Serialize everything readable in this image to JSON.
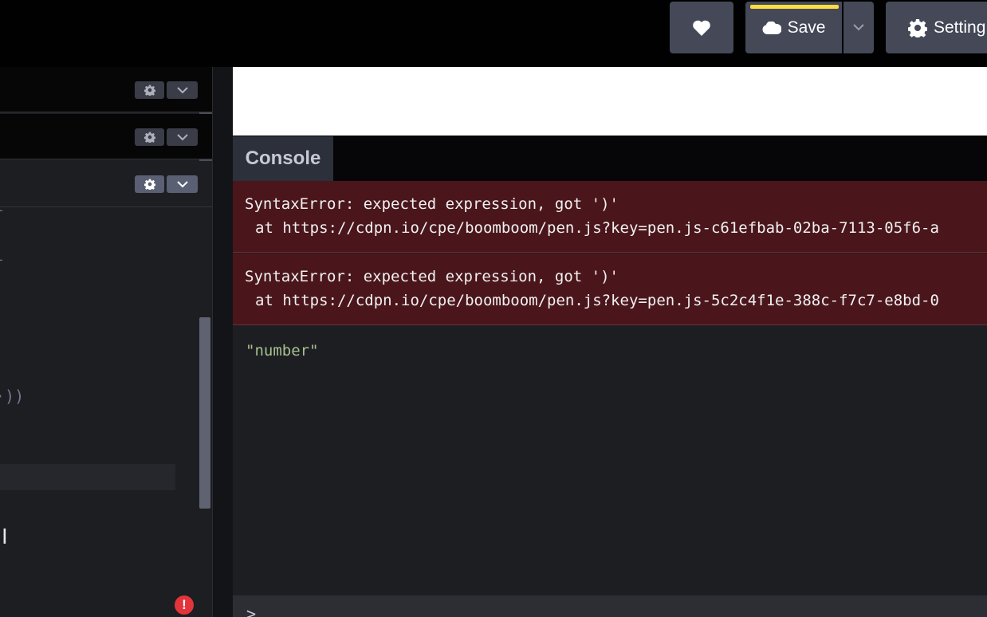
{
  "header": {
    "heart_icon": "heart-icon",
    "save_label": "Save",
    "save_icon": "cloud-icon",
    "save_caret_icon": "chevron-down-icon",
    "settings_label": "Setting",
    "settings_icon": "gear-icon",
    "save_accent": "#ffdd40"
  },
  "editors": {
    "panels": [
      {
        "gear_icon": "gear-icon",
        "caret_icon": "chevron-down-icon"
      },
      {
        "gear_icon": "gear-icon",
        "caret_icon": "chevron-down-icon"
      },
      {
        "gear_icon": "gear-icon",
        "caret_icon": "chevron-down-icon"
      }
    ],
    "code_fragments": [
      "-",
      "-",
      "·))"
    ],
    "error_badge": "!"
  },
  "console": {
    "tab_label": "Console",
    "logs": [
      {
        "type": "error",
        "message": "SyntaxError: expected expression, got ')'",
        "location": "at https://cdpn.io/cpe/boomboom/pen.js?key=pen.js-c61efbab-02ba-7113-05f6-a"
      },
      {
        "type": "error",
        "message": "SyntaxError: expected expression, got ')'",
        "location": "at https://cdpn.io/cpe/boomboom/pen.js?key=pen.js-5c2c4f1e-388c-f7c7-e8bd-0"
      },
      {
        "type": "value",
        "message": "\"number\""
      }
    ],
    "prompt": ">"
  }
}
